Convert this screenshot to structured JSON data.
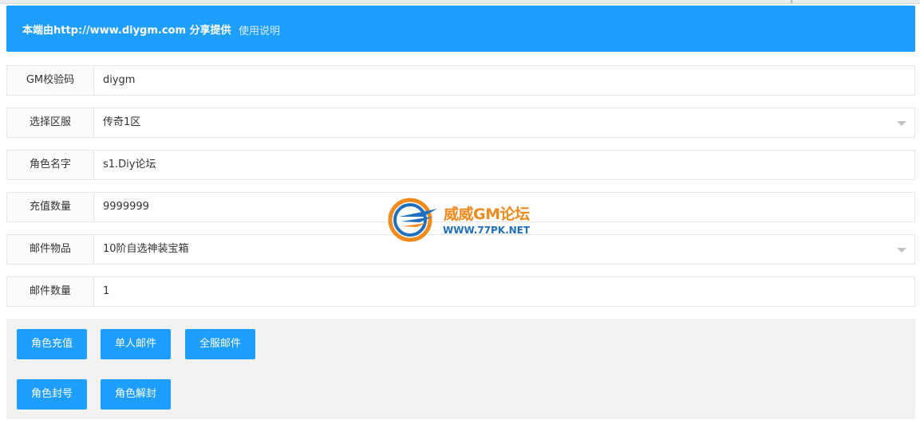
{
  "header": {
    "brand": "本端由http://www.diygm.com 分享提供",
    "help_link": "使用说明",
    "color": "#1e9fff"
  },
  "form": {
    "gm_code": {
      "label": "GM校验码",
      "value": "diygm"
    },
    "server": {
      "label": "选择区服",
      "value": "传奇1区"
    },
    "role_name": {
      "label": "角色名字",
      "value": "s1.Diy论坛"
    },
    "recharge_amount": {
      "label": "充值数量",
      "value": "9999999"
    },
    "mail_item": {
      "label": "邮件物品",
      "value": "10阶自选神装宝箱"
    },
    "mail_count": {
      "label": "邮件数量",
      "value": "1"
    }
  },
  "actions": {
    "recharge": "角色充值",
    "single_mail": "单人邮件",
    "all_mail": "全服邮件",
    "ban": "角色封号",
    "unban": "角色解封"
  },
  "watermark": {
    "title": "威威GM论坛",
    "url": "WWW.77PK.NET"
  },
  "icons": {
    "dropdown": "chevron-down-icon",
    "logo": "logo-icon"
  }
}
